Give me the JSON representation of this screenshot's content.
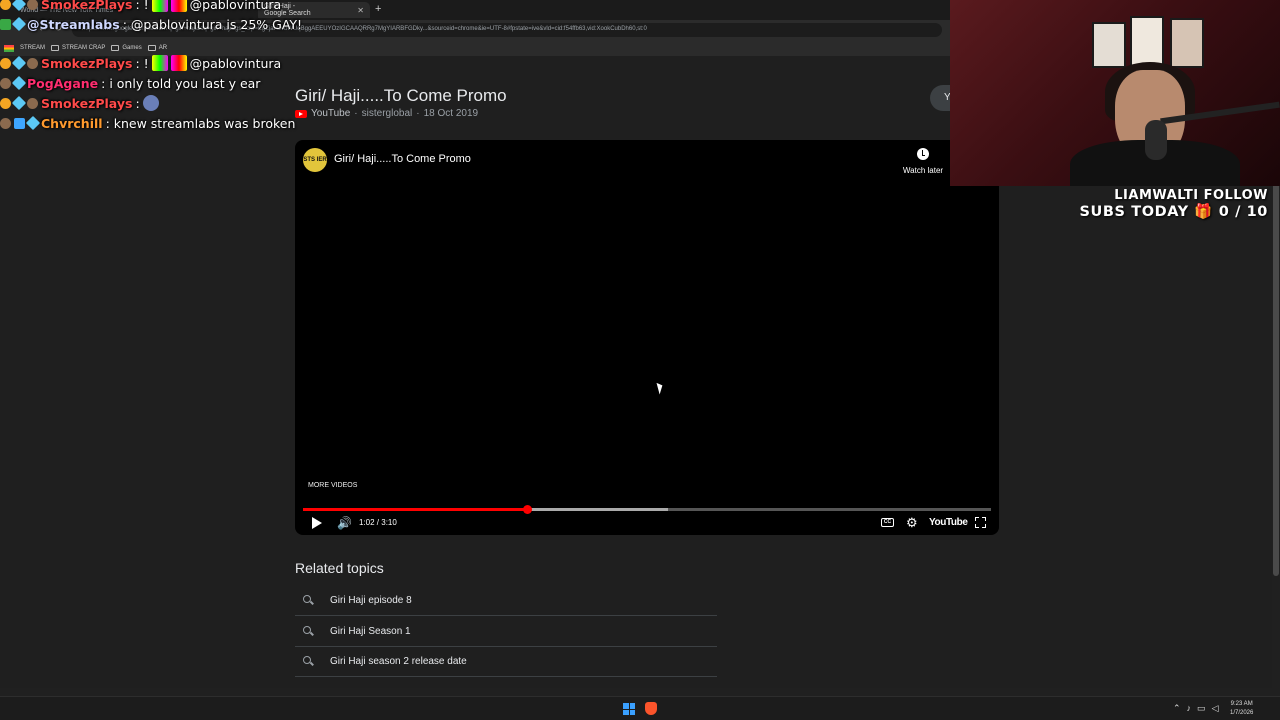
{
  "browser": {
    "tabs": [
      {
        "label": "World — The New York Times"
      },
      {
        "label": "Giri/ Haji - Google Search"
      }
    ],
    "address": "https://www.google.com/search?q=giri+haji&oq=giri+haji&gs_lcrp=EgZjaHJvbWUqBggAEEUYOzIGCAAQRRg7MgYIARBFGDky...&sourceid=chrome&ie=UTF-8#fpstate=ive&vld=cid:f54ffb63,vid:XookCubDh60,st:0",
    "bookmarks": [
      {
        "label": "STREAM"
      },
      {
        "label": "STREAM CRAP"
      },
      {
        "label": "Games"
      },
      {
        "label": "AR"
      }
    ]
  },
  "result": {
    "title": "Giri/ Haji.....To Come Promo",
    "source": "YouTube",
    "channel": "sisterglobal",
    "date": "18 Oct 2019",
    "right_pill": "Y"
  },
  "player": {
    "channel_avatar": "STS IER",
    "video_title": "Giri/ Haji.....To Come Promo",
    "watch_later": "Watch later",
    "more_videos": "MORE VIDEOS",
    "time": "1:02 / 3:10",
    "progress": 0.325,
    "buffered": 0.53,
    "cc_label": "CC",
    "youtube_logo": "YouTube"
  },
  "related": {
    "heading": "Related topics",
    "items": [
      {
        "label": "Giri Haji episode 8"
      },
      {
        "label": "Giri Haji Season 1"
      },
      {
        "label": "Giri Haji season 2 release date"
      }
    ]
  },
  "chat": [
    {
      "user": "SmokezPlays",
      "color": "#ff4a4a",
      "text": ": !",
      "tail": "@pablovintura"
    },
    {
      "user": "@Streamlabs",
      "color": "#cfd8ff",
      "text": ": @pablovintura is 25% GAY!",
      "tail": ""
    },
    {
      "user": "SmokezPlays",
      "color": "#ff4a4a",
      "text": ": !",
      "tail": "@pablovintura"
    },
    {
      "user": "PogAgane",
      "color": "#ff2d6f",
      "text": ": i only told you last y ear",
      "tail": ""
    },
    {
      "user": "SmokezPlays",
      "color": "#ff4a4a",
      "text": ":",
      "tail": ""
    },
    {
      "user": "Chvrchill",
      "color": "#ff9a2e",
      "text": ": knew streamlabs was broken",
      "tail": ""
    }
  ],
  "goal": {
    "line1": "LIAMWALTI FOLLOW",
    "line2": "SUBS TODAY 🎁 0 / 10"
  },
  "taskbar": {
    "time": "9:23 AM",
    "date": "1/7/2026"
  },
  "colors": {
    "accent": "#ff0000",
    "page_bg": "#1f1f1f"
  }
}
